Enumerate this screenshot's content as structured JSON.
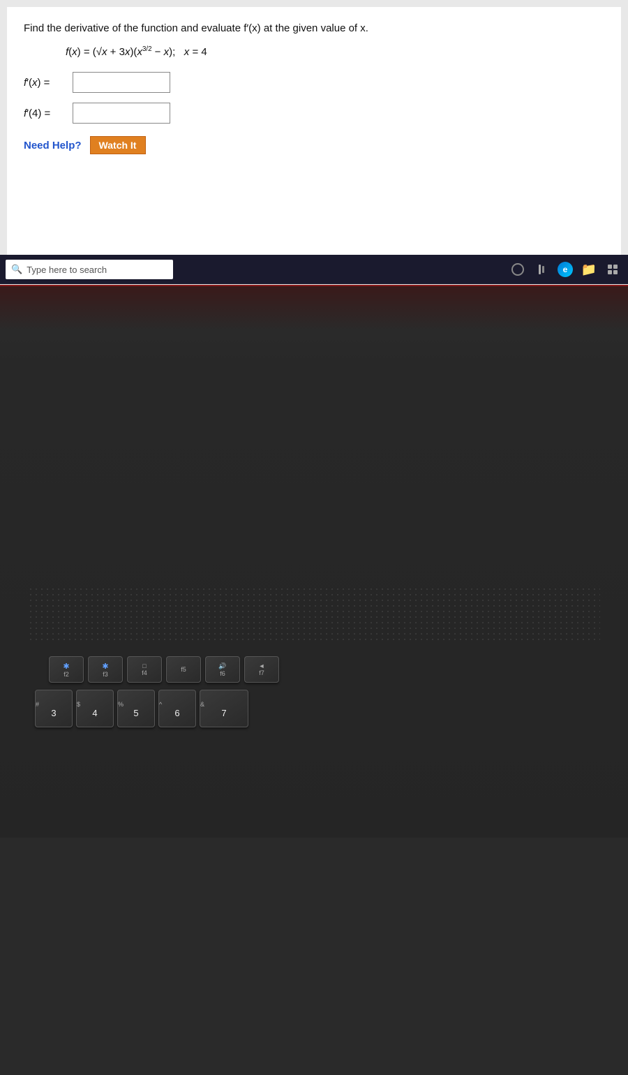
{
  "screen": {
    "problem_statement": "Find the derivative of the function and evaluate f′(x) at the given value of x.",
    "formula": "f(x) = (√x + 3x)(x³⁄² − x);   x = 4",
    "fprime_label": "f′(x) =",
    "fprime4_label": "f′(4) =",
    "need_help_label": "Need Help?",
    "watch_it_label": "Watch It",
    "fprime_value": "",
    "fprime4_value": ""
  },
  "taskbar": {
    "search_placeholder": "Type here to search",
    "icons": [
      "cortana",
      "task-view",
      "edge",
      "file-explorer",
      "apps-grid"
    ]
  },
  "keyboard": {
    "fn_row": [
      {
        "label": "f2",
        "icon": "✱"
      },
      {
        "label": "f3",
        "icon": "✱"
      },
      {
        "label": "f4",
        "icon": "□"
      },
      {
        "label": "f5",
        "icon": ""
      },
      {
        "label": "f6",
        "icon": "🔊"
      },
      {
        "label": "f7",
        "icon": "◄"
      }
    ],
    "num_row": [
      {
        "shift": "#",
        "main": "3"
      },
      {
        "shift": "$",
        "main": "4"
      },
      {
        "shift": "%",
        "main": "5"
      },
      {
        "shift": "^",
        "main": "6"
      },
      {
        "shift": "&",
        "main": "7"
      }
    ]
  },
  "colors": {
    "watch_it_bg": "#e08020",
    "screen_bg": "#e8e8e8",
    "content_bg": "#ffffff",
    "taskbar_bg": "#1a1a2e",
    "laptop_body": "#2a2a2a",
    "red_strip": "#8b1a1a"
  }
}
